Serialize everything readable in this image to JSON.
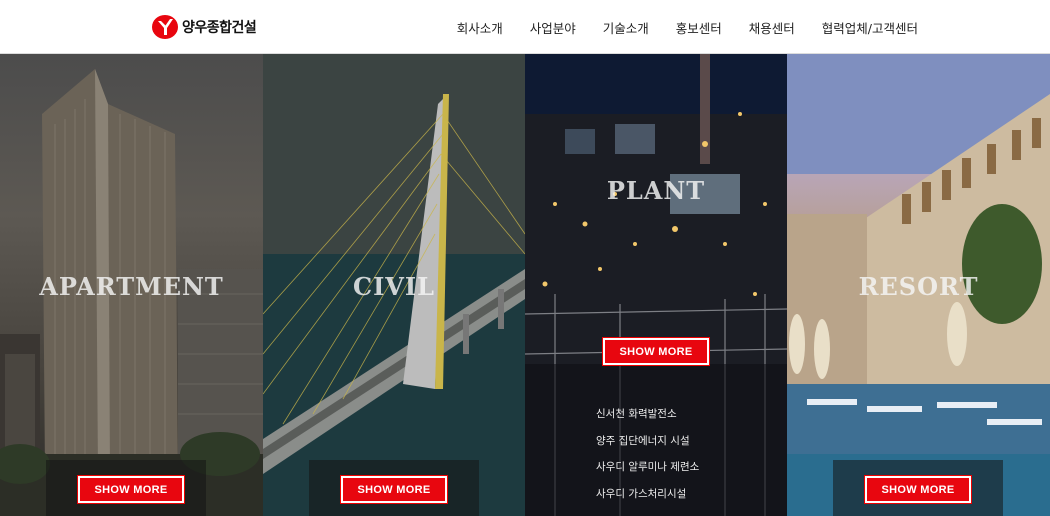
{
  "brand": {
    "name": "양우종합건설",
    "accent": "#e8060f"
  },
  "nav": [
    "회사소개",
    "사업분야",
    "기술소개",
    "홍보센터",
    "채용센터",
    "협력업체/고객센터"
  ],
  "panels": [
    {
      "title": "APARTMENT",
      "button": "SHOW MORE"
    },
    {
      "title": "CIVIL",
      "button": "SHOW MORE"
    },
    {
      "title": "PLANT",
      "button": "SHOW MORE",
      "projects": [
        "신서천 화력발전소",
        "양주 집단에너지 시설",
        "사우디 알루미나 제련소",
        "사우디 가스처리시설"
      ]
    },
    {
      "title": "RESORT",
      "button": "SHOW MORE"
    }
  ]
}
